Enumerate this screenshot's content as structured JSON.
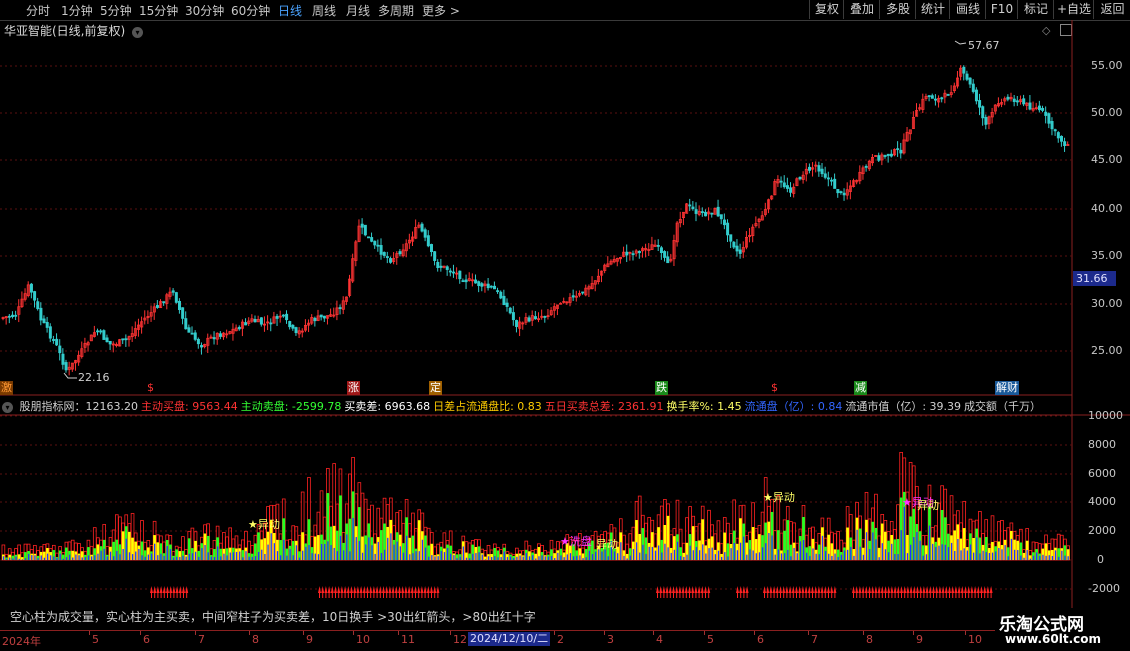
{
  "toolbar": {
    "periods": [
      {
        "label": "分时",
        "active": false
      },
      {
        "label": "1分钟",
        "active": false
      },
      {
        "label": "5分钟",
        "active": false
      },
      {
        "label": "15分钟",
        "active": false
      },
      {
        "label": "30分钟",
        "active": false
      },
      {
        "label": "60分钟",
        "active": false
      },
      {
        "label": "日线",
        "active": true
      },
      {
        "label": "周线",
        "active": false
      },
      {
        "label": "月线",
        "active": false
      },
      {
        "label": "多周期",
        "active": false
      },
      {
        "label": "更多 >",
        "active": false
      }
    ],
    "right_buttons": [
      "复权",
      "叠加",
      "多股",
      "统计",
      "画线",
      "F10",
      "标记",
      "+自选",
      "返回"
    ]
  },
  "stock_title": "华亚智能(日线,前复权)",
  "price_axis": [
    "55.00",
    "50.00",
    "45.00",
    "40.00",
    "35.00",
    "30.00",
    "25.00"
  ],
  "current_price": "31.66",
  "high_label": "57.67",
  "low_label": "22.16",
  "event_tags": [
    {
      "text": "激",
      "color": "#ff9933",
      "bg": "#7a3a00"
    },
    {
      "text": "$",
      "color": "#ff3333",
      "bg": ""
    },
    {
      "text": "涨",
      "color": "#ffffff",
      "bg": "#a01818"
    },
    {
      "text": "定",
      "color": "#ffffff",
      "bg": "#a06000"
    },
    {
      "text": "跌",
      "color": "#ffffff",
      "bg": "#1a8a1a"
    },
    {
      "text": "$",
      "color": "#ff3333",
      "bg": ""
    },
    {
      "text": "减",
      "color": "#ffffff",
      "bg": "#1a8a1a"
    },
    {
      "text": "解财",
      "color": "#ffffff",
      "bg": "#1a5a9a"
    }
  ],
  "indicator": {
    "name": "股朋指标网",
    "items": [
      {
        "label": "股朋指标网：12163.20",
        "color": "#d0d0d0"
      },
      {
        "label": "主动买盘: 9563.44",
        "color": "#ff3333"
      },
      {
        "label": "主动卖盘: -2599.78",
        "color": "#33ff33"
      },
      {
        "label": "买卖差: 6963.68",
        "color": "#ffffff"
      },
      {
        "label": "日差占流通盘比: 0.83",
        "color": "#ffcc00"
      },
      {
        "label": "五日买卖总差: 2361.91",
        "color": "#ff3333"
      },
      {
        "label": "换手率%: 1.45",
        "color": "#ffff66"
      },
      {
        "label": "流通盘（亿）: 0.84",
        "color": "#3366ff"
      },
      {
        "label": "流通市值（亿）: 39.39",
        "color": "#d0d0d0"
      },
      {
        "label": "成交额（千万）",
        "color": "#d0d0d0"
      }
    ]
  },
  "indicator_axis": [
    "10000",
    "8000",
    "6000",
    "4000",
    "2000",
    "0",
    "-2000"
  ],
  "signals": [
    {
      "text": "★异动",
      "color": "#ffff66"
    },
    {
      "text": "★洗盘",
      "color": "#ff33ff"
    },
    {
      "text": "异动",
      "color": "#ffff66"
    },
    {
      "text": "★异动",
      "color": "#ffff66"
    },
    {
      "text": "★异动",
      "color": "#ff33ff"
    },
    {
      "text": "异动",
      "color": "#ffff66"
    }
  ],
  "note": "空心柱为成交量，实心柱为主买卖，中间窄柱子为买卖差，10日换手 >30出红箭头，>80出红十字",
  "date_axis": {
    "labels": [
      "2024年",
      "5",
      "6",
      "7",
      "8",
      "9",
      "10",
      "11",
      "12",
      "2",
      "3",
      "4",
      "5",
      "6",
      "7",
      "8",
      "9",
      "10",
      "1"
    ],
    "current": "2024/12/10/二"
  },
  "colors": {
    "up": "#ff3333",
    "down": "#33cccc",
    "grid": "#5a1010",
    "volume": "#ff2222",
    "buy": "#ffff00",
    "sell": "#22ff22",
    "diff": "#2233ff"
  }
}
